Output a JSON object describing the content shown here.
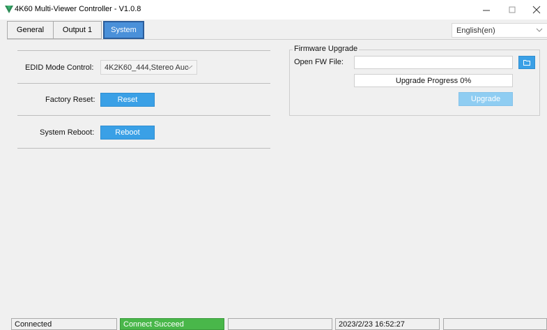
{
  "window": {
    "title": "4K60 Multi-Viewer Controller - V1.0.8",
    "controls": {
      "minimize": "—",
      "maximize": "☐",
      "close": "✕"
    }
  },
  "tabs": [
    {
      "label": "General",
      "active": false
    },
    {
      "label": "Output 1",
      "active": false
    },
    {
      "label": "System",
      "active": true
    }
  ],
  "language": {
    "selected": "English(en)"
  },
  "system": {
    "edid_label": "EDID Mode Control:",
    "edid_value": "4K2K60_444,Stereo Auc",
    "factory_reset_label": "Factory Reset:",
    "reset_button": "Reset",
    "system_reboot_label": "System Reboot:",
    "reboot_button": "Reboot"
  },
  "firmware": {
    "group_title": "Firmware Upgrade",
    "open_label": "Open FW File:",
    "file_path": "",
    "progress_text": "Upgrade Progress 0%",
    "progress_value": 0,
    "upgrade_button": "Upgrade"
  },
  "statusbar": {
    "connection": "Connected",
    "result": "Connect Succeed",
    "empty1": "",
    "datetime": "2023/2/23 16:52:27",
    "empty2": ""
  },
  "colors": {
    "accent": "#3aa0e6",
    "status_ok": "#49b74a",
    "disabled_button": "#8fcdf2"
  }
}
